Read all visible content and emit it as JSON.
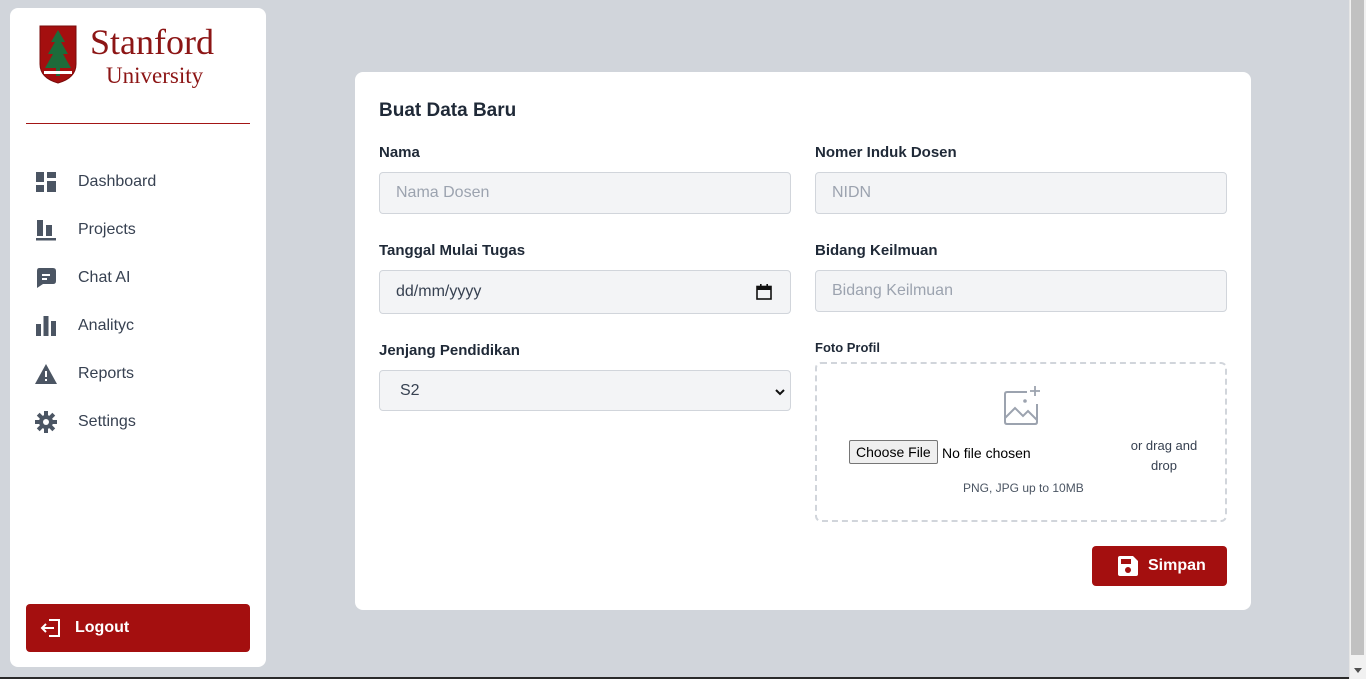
{
  "sidebar": {
    "logo": {
      "line1": "Stanford",
      "line2": "University"
    },
    "items": [
      {
        "label": "Dashboard",
        "icon": "dashboard-icon"
      },
      {
        "label": "Projects",
        "icon": "projects-icon"
      },
      {
        "label": "Chat AI",
        "icon": "chat-icon"
      },
      {
        "label": "Analityc",
        "icon": "analytics-icon"
      },
      {
        "label": "Reports",
        "icon": "warning-icon"
      },
      {
        "label": "Settings",
        "icon": "gear-icon"
      }
    ],
    "logout_label": "Logout"
  },
  "form": {
    "title": "Buat Data Baru",
    "nama": {
      "label": "Nama",
      "placeholder": "Nama Dosen"
    },
    "nidn": {
      "label": "Nomer Induk Dosen",
      "placeholder": "NIDN"
    },
    "tanggal": {
      "label": "Tanggal Mulai Tugas",
      "placeholder": "dd/mm/yyyy"
    },
    "bidang": {
      "label": "Bidang Keilmuan",
      "placeholder": "Bidang Keilmuan"
    },
    "jenjang": {
      "label": "Jenjang Pendidikan",
      "value": "S2"
    },
    "foto": {
      "label": "Foto Profil",
      "choose_label": "Choose File",
      "no_file": "No file chosen",
      "drag_text": "or drag and drop",
      "hint": "PNG, JPG up to 10MB"
    },
    "save_label": "Simpan"
  },
  "colors": {
    "brand": "#a40f0f",
    "background": "#d1d5db",
    "input_bg": "#f3f4f6"
  }
}
